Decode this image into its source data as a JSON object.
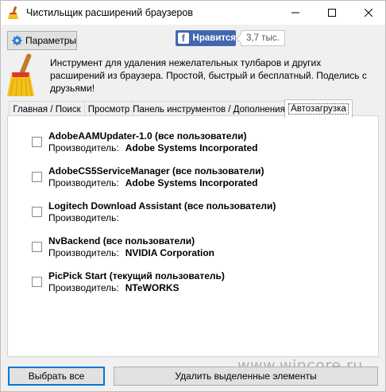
{
  "window": {
    "title": "Чистильщик расширений браузеров",
    "icon": "broom-icon"
  },
  "toolbar": {
    "params_label": "Параметры",
    "fb_like_label": "Нравится",
    "fb_count": "3,7 тыс."
  },
  "description": "Инструмент для удаления нежелательных тулбаров и других расширений из браузера. Простой, быстрый и бесплатный. Поделись с друзьями!",
  "tabs": [
    {
      "label": "Главная / Поиск",
      "active": false
    },
    {
      "label": "Просмотр",
      "active": false
    },
    {
      "label": "Панель инструментов / Дополнения",
      "active": false
    },
    {
      "label": "Автозагрузка",
      "active": true
    }
  ],
  "vendor_label": "Производитель:",
  "items": [
    {
      "name": "AdobeAAMUpdater-1.0 (все пользователи)",
      "vendor": "Adobe Systems Incorporated",
      "checked": false
    },
    {
      "name": "AdobeCS5ServiceManager (все пользователи)",
      "vendor": "Adobe Systems Incorporated",
      "checked": false
    },
    {
      "name": "Logitech Download Assistant (все пользователи)",
      "vendor": "",
      "checked": false
    },
    {
      "name": "NvBackend (все пользователи)",
      "vendor": "NVIDIA Corporation",
      "checked": false
    },
    {
      "name": "PicPick Start (текущий пользователь)",
      "vendor": "NTeWORKS",
      "checked": false
    }
  ],
  "footer": {
    "select_all_label": "Выбрать все",
    "delete_label": "Удалить выделенные элементы"
  },
  "watermark": "www.wincore.ru",
  "colors": {
    "fb_blue": "#4267b2",
    "focus_blue": "#0078d7"
  }
}
